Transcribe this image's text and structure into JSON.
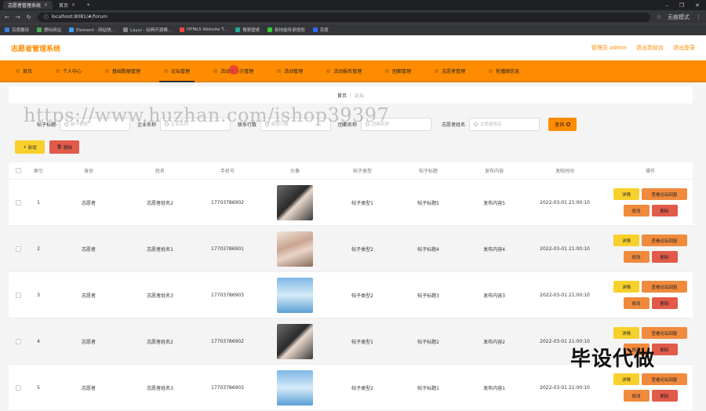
{
  "browser": {
    "tabs": [
      {
        "label": "志愿者管理系统",
        "active": true
      },
      {
        "label": "首页",
        "active": false
      }
    ],
    "url": "localhost:8081/#/forum",
    "profile": "无痕模式",
    "bookmarks": [
      "百度翻译",
      "鹿标网站",
      "Element - 网站快...",
      "Layui - 经典开源模...",
      "HTML5 Website T...",
      "搜索壁纸",
      "新技能传承规划",
      "百度"
    ]
  },
  "header": {
    "title": "志愿者管理系统",
    "links": [
      "管理员 admin",
      "退出到前台",
      "退出登录"
    ]
  },
  "nav": {
    "items": [
      "首页",
      "个人中心",
      "基础数据管理",
      "论坛管理",
      "活动承办方管理",
      "活动管理",
      "活动报名管理",
      "团都管理",
      "志愿者管理",
      "轮播图信息"
    ]
  },
  "breadcrumb": {
    "home": "首页",
    "current": "论坛"
  },
  "filters": {
    "f1_label": "帖子标题",
    "f1_placeholder": "帖子标题",
    "f2_label": "企业名称",
    "f2_placeholder": "企业名称",
    "f3_label": "联系行数",
    "f3_placeholder": "联系行数",
    "f4_label": "团都名称",
    "f4_placeholder": "团都名称",
    "f5_label": "志愿者姓名",
    "f5_placeholder": "志愿者姓名",
    "search_label": "查询"
  },
  "actions": {
    "add": "新增",
    "delete": "删除"
  },
  "table": {
    "headers": [
      "索引",
      "身份",
      "姓名",
      "手机号",
      "头像",
      "帖子类型",
      "帖子标题",
      "发布内容",
      "发帖时间",
      "操作"
    ],
    "rows": [
      {
        "idx": "1",
        "role": "志愿者",
        "name": "志愿者姓名2",
        "phone": "17703786902",
        "avatar": "dark",
        "type": "帖子类型1",
        "title": "帖子标题5",
        "content": "发布内容5",
        "time": "2022-03-01 21:00:10"
      },
      {
        "idx": "2",
        "role": "志愿者",
        "name": "志愿者姓名1",
        "phone": "17703786901",
        "avatar": "light",
        "type": "帖子类型2",
        "title": "帖子标题4",
        "content": "发布内容4",
        "time": "2022-03-01 21:00:10"
      },
      {
        "idx": "3",
        "role": "志愿者",
        "name": "志愿者姓名3",
        "phone": "17703786903",
        "avatar": "blue",
        "type": "帖子类型2",
        "title": "帖子标题3",
        "content": "发布内容3",
        "time": "2022-03-01 21:00:10"
      },
      {
        "idx": "4",
        "role": "志愿者",
        "name": "志愿者姓名2",
        "phone": "17703786902",
        "avatar": "dark",
        "type": "帖子类型1",
        "title": "帖子标题2",
        "content": "发布内容2",
        "time": "2022-03-01 21:00:10"
      },
      {
        "idx": "5",
        "role": "志愿者",
        "name": "志愿者姓名3",
        "phone": "17703786903",
        "avatar": "blue",
        "type": "帖子类型2",
        "title": "帖子标题1",
        "content": "发布内容1",
        "time": "2022-03-01 21:00:10"
      }
    ],
    "ops": {
      "detail": "详情",
      "reply": "查看论坛回复",
      "edit": "修改",
      "remove": "删除"
    }
  },
  "overlay": {
    "watermark": "https://www.huzhan.com/ishop39397",
    "stamp": "毕设代做"
  },
  "colors": {
    "accent": "#ff8c00",
    "yellow": "#f7d02c",
    "red": "#e25a4a"
  }
}
